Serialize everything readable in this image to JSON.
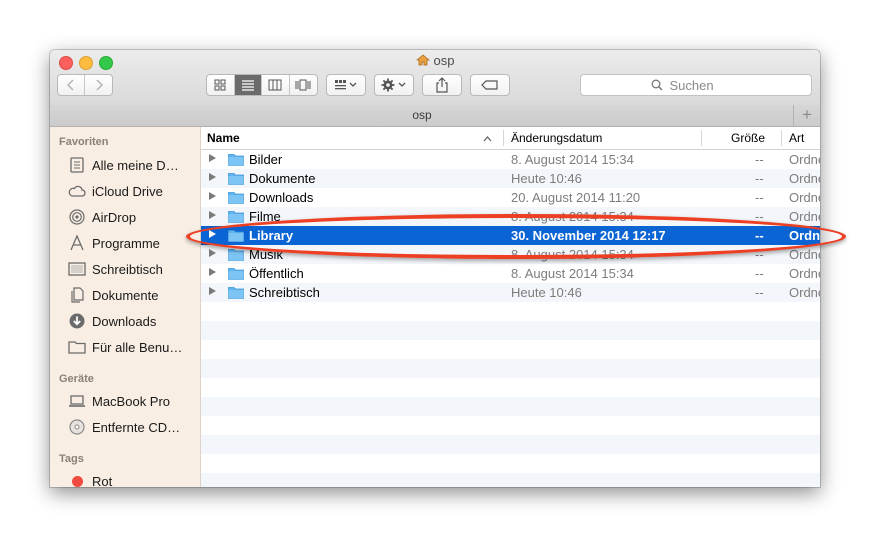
{
  "window": {
    "title": "osp"
  },
  "toolbar": {
    "search_placeholder": "Suchen"
  },
  "tab": {
    "label": "osp",
    "add_label": "+"
  },
  "sidebar": {
    "sections": [
      {
        "label": "Favoriten"
      },
      {
        "label": "Geräte"
      },
      {
        "label": "Tags"
      }
    ],
    "favorites": [
      {
        "label": "Alle meine D…",
        "icon": "all-my-files-icon"
      },
      {
        "label": "iCloud Drive",
        "icon": "cloud-icon"
      },
      {
        "label": "AirDrop",
        "icon": "airdrop-icon"
      },
      {
        "label": "Programme",
        "icon": "applications-icon"
      },
      {
        "label": "Schreibtisch",
        "icon": "desktop-icon"
      },
      {
        "label": "Dokumente",
        "icon": "documents-icon"
      },
      {
        "label": "Downloads",
        "icon": "downloads-icon"
      },
      {
        "label": "Für alle Benu…",
        "icon": "folder-icon"
      }
    ],
    "devices": [
      {
        "label": "MacBook Pro",
        "icon": "laptop-icon"
      },
      {
        "label": "Entfernte CD…",
        "icon": "disc-icon"
      }
    ],
    "tags": [
      {
        "label": "Rot",
        "color": "#f04b40"
      }
    ]
  },
  "list": {
    "columns": {
      "name": "Name",
      "sort_indicator": "^",
      "date": "Änderungsdatum",
      "size": "Größe",
      "kind": "Art"
    },
    "rows": [
      {
        "name": "Bilder",
        "date": "8. August 2014 15:34",
        "size": "--",
        "kind": "Ordner"
      },
      {
        "name": "Dokumente",
        "date": "Heute 10:46",
        "size": "--",
        "kind": "Ordner"
      },
      {
        "name": "Downloads",
        "date": "20. August 2014 11:20",
        "size": "--",
        "kind": "Ordner"
      },
      {
        "name": "Filme",
        "date": "8. August 2014 15:34",
        "size": "--",
        "kind": "Ordner"
      },
      {
        "name": "Library",
        "date": "30. November 2014 12:17",
        "size": "--",
        "kind": "Ordner",
        "selected": true
      },
      {
        "name": "Musik",
        "date": "8. August 2014 15:34",
        "size": "--",
        "kind": "Ordner"
      },
      {
        "name": "Öffentlich",
        "date": "8. August 2014 15:34",
        "size": "--",
        "kind": "Ordner"
      },
      {
        "name": "Schreibtisch",
        "date": "Heute 10:46",
        "size": "--",
        "kind": "Ordner"
      }
    ]
  },
  "colors": {
    "selection": "#0a64d4",
    "highlight_ring": "#ec3f24",
    "sidebar_bg": "#f8eee3",
    "folder": "#5fb4ef"
  }
}
